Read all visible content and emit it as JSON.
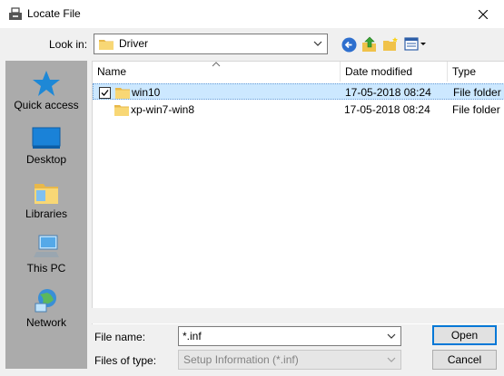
{
  "window": {
    "title": "Locate File",
    "close_glyph": "✕"
  },
  "look_in": {
    "label": "Look in:",
    "value": "Driver"
  },
  "toolbar": {
    "back_icon": "back-arrow-icon",
    "up_icon": "up-folder-icon",
    "new_folder_icon": "new-folder-icon",
    "view_icon": "view-menu-icon"
  },
  "places": [
    {
      "label": "Quick access",
      "icon": "star-icon"
    },
    {
      "label": "Desktop",
      "icon": "desktop-icon"
    },
    {
      "label": "Libraries",
      "icon": "libraries-icon"
    },
    {
      "label": "This PC",
      "icon": "computer-icon"
    },
    {
      "label": "Network",
      "icon": "network-icon"
    }
  ],
  "file_list": {
    "columns": [
      "Name",
      "Date modified",
      "Type"
    ],
    "rows": [
      {
        "name": "win10",
        "date": "17-05-2018 08:24",
        "type": "File folder",
        "selected": true,
        "checked": true
      },
      {
        "name": "xp-win7-win8",
        "date": "17-05-2018 08:24",
        "type": "File folder",
        "selected": false,
        "checked": false
      }
    ]
  },
  "file_name": {
    "label": "File name:",
    "value": "*.inf"
  },
  "files_of_type": {
    "label": "Files of type:",
    "value": "Setup Information (*.inf)"
  },
  "buttons": {
    "open": "Open",
    "cancel": "Cancel"
  },
  "colors": {
    "selection": "#cce8ff",
    "accent": "#0078d7",
    "places_bg": "#ababab",
    "folder": "#f8d775"
  }
}
